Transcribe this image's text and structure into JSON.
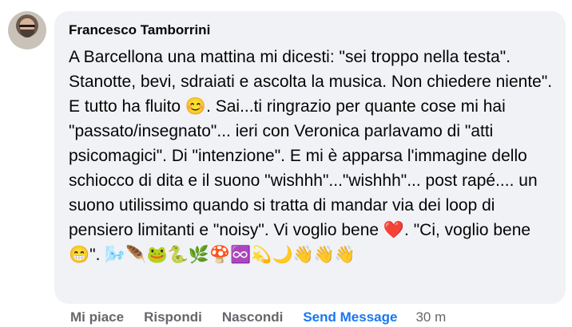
{
  "comment": {
    "author": "Francesco Tamborrini",
    "text": "A Barcellona una mattina mi dicesti: \"sei troppo nella testa\". Stanotte, bevi, sdraiati e ascolta la musica. Non chiedere niente\". E tutto ha fluito 😊. Sai...ti ringrazio per quante cose mi hai \"passato/insegnato\"... ieri con Veronica parlavamo di \"atti psicomagici\". Di \"intenzione\". E mi è apparsa l'immagine dello schiocco di dita e il suono \"wishhh\"...\"wishhh\"... post rapé.... un suono utilissimo quando si tratta di mandar via dei loop di pensiero limitanti e \"noisy\". Vi voglio bene ❤️. \"Ci, voglio bene 😁\". 🌬️🪶🐸🐍🌿🍄♾️💫🌙👋👋👋"
  },
  "actions": {
    "like": "Mi piace",
    "reply": "Rispondi",
    "hide": "Nascondi",
    "send_message": "Send Message",
    "timestamp": "30 m"
  },
  "colors": {
    "bubble_background": "#f0f2f5",
    "text": "#050505",
    "secondary_text": "#65676b",
    "link": "#1877f2"
  }
}
